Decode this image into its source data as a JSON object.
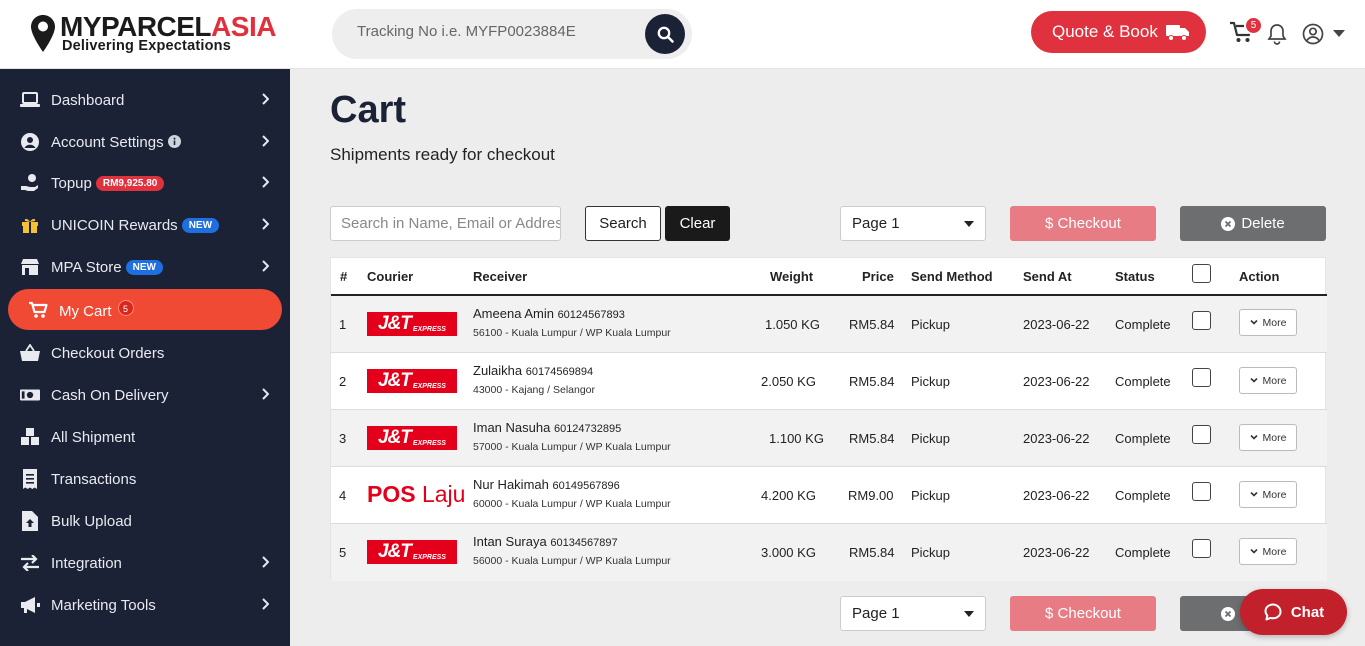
{
  "brand": {
    "name_part1": "MYPARCEL",
    "name_part2": "ASIA",
    "tagline": "Delivering Expectations",
    "accent": "#e0323e"
  },
  "header": {
    "tracking_placeholder": "Tracking No i.e. MYFP0023884E",
    "quote_label": "Quote & Book",
    "cart_count": "5"
  },
  "sidebar": {
    "items": [
      {
        "label": "Dashboard",
        "icon": "laptop-icon",
        "badge": "",
        "arrow": true
      },
      {
        "label": "Account Settings",
        "icon": "user-circle-icon",
        "badge": "",
        "arrow": true
      },
      {
        "label": "Topup",
        "icon": "topup-icon",
        "badge": "RM9,925.80",
        "arrow": true
      },
      {
        "label": "UNICOIN Rewards",
        "icon": "gift-icon",
        "badge": "NEW",
        "arrow": true
      },
      {
        "label": "MPA Store",
        "icon": "store-icon",
        "badge": "NEW",
        "arrow": true
      },
      {
        "label": "My Cart",
        "icon": "cart-icon",
        "badge": "5",
        "arrow": false
      },
      {
        "label": "Checkout Orders",
        "icon": "basket-icon",
        "badge": "",
        "arrow": false
      },
      {
        "label": "Cash On Delivery",
        "icon": "money-icon",
        "badge": "",
        "arrow": true
      },
      {
        "label": "All Shipment",
        "icon": "boxes-icon",
        "badge": "",
        "arrow": false
      },
      {
        "label": "Transactions",
        "icon": "receipt-icon",
        "badge": "",
        "arrow": false
      },
      {
        "label": "Bulk Upload",
        "icon": "file-upload-icon",
        "badge": "",
        "arrow": false
      },
      {
        "label": "Integration",
        "icon": "exchange-icon",
        "badge": "",
        "arrow": true
      },
      {
        "label": "Marketing Tools",
        "icon": "megaphone-icon",
        "badge": "",
        "arrow": true
      }
    ]
  },
  "main": {
    "title": "Cart",
    "subtitle": "Shipments ready for checkout",
    "search_placeholder": "Search in Name, Email or Address",
    "search_label": "Search",
    "clear_label": "Clear",
    "page_value": "Page 1",
    "checkout_label": "$ Checkout",
    "delete_label": "Delete"
  },
  "table": {
    "headers": {
      "num": "#",
      "courier": "Courier",
      "receiver": "Receiver",
      "weight": "Weight",
      "price": "Price",
      "method": "Send Method",
      "send_at": "Send At",
      "status": "Status",
      "action": "Action"
    },
    "more_label": "More",
    "rows": [
      {
        "num": "1",
        "courier": "J&T Express",
        "name": "Ameena Amin",
        "phone": "60124567893",
        "address": "56100 - Kuala Lumpur / WP Kuala Lumpur",
        "weight": "1.050 KG",
        "price": "RM5.84",
        "method": "Pickup",
        "send_at": "2023-06-22",
        "status": "Complete"
      },
      {
        "num": "2",
        "courier": "J&T Express",
        "name": "Zulaikha",
        "phone": "60174569894",
        "address": "43000 - Kajang / Selangor",
        "weight": "2.050 KG",
        "price": "RM5.84",
        "method": "Pickup",
        "send_at": "2023-06-22",
        "status": "Complete"
      },
      {
        "num": "3",
        "courier": "J&T Express",
        "name": "Iman Nasuha",
        "phone": "60124732895",
        "address": "57000 - Kuala Lumpur / WP Kuala Lumpur",
        "weight": "1.100 KG",
        "price": "RM5.84",
        "method": "Pickup",
        "send_at": "2023-06-22",
        "status": "Complete"
      },
      {
        "num": "4",
        "courier": "Pos Laju",
        "name": "Nur Hakimah",
        "phone": "60149567896",
        "address": "60000 - Kuala Lumpur / WP Kuala Lumpur",
        "weight": "4.200 KG",
        "price": "RM9.00",
        "method": "Pickup",
        "send_at": "2023-06-22",
        "status": "Complete"
      },
      {
        "num": "5",
        "courier": "J&T Express",
        "name": "Intan Suraya",
        "phone": "60134567897",
        "address": "56000 - Kuala Lumpur / WP Kuala Lumpur",
        "weight": "3.000 KG",
        "price": "RM5.84",
        "method": "Pickup",
        "send_at": "2023-06-22",
        "status": "Complete"
      }
    ]
  },
  "chat": {
    "label": "Chat"
  }
}
